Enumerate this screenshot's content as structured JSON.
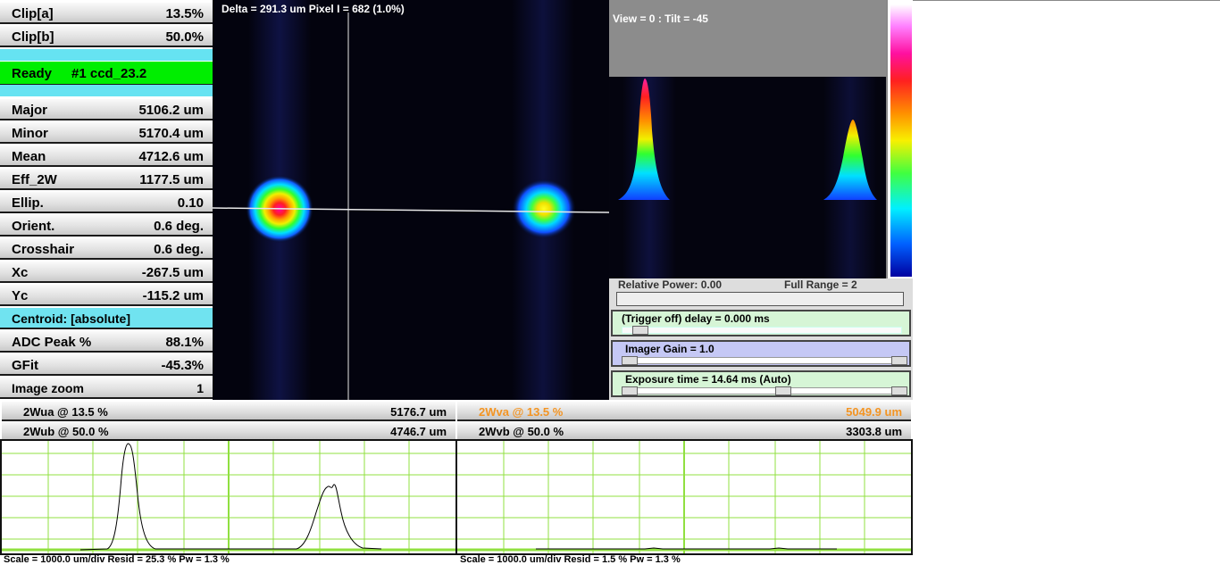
{
  "left_panel": {
    "clip_a": {
      "label": "Clip[a]",
      "value": "13.5%"
    },
    "clip_b": {
      "label": "Clip[b]",
      "value": "50.0%"
    },
    "status": {
      "state": "Ready",
      "camera": "#1 ccd_23.2"
    },
    "measurements": [
      {
        "label": "Major",
        "value": "5106.2 um"
      },
      {
        "label": "Minor",
        "value": "5170.4 um"
      },
      {
        "label": "Mean",
        "value": "4712.6 um"
      },
      {
        "label": "Eff_2W",
        "value": "1177.5 um"
      },
      {
        "label": "Ellip.",
        "value": "0.10"
      },
      {
        "label": "Orient.",
        "value": "0.6 deg."
      },
      {
        "label": "Crosshair",
        "value": "0.6 deg."
      },
      {
        "label": "Xc",
        "value": "-267.5 um"
      },
      {
        "label": "Yc",
        "value": "-115.2 um"
      }
    ],
    "centroid": "Centroid: [absolute]",
    "adc_peak": {
      "label": "ADC Peak %",
      "value": "88.1%"
    },
    "gfit": {
      "label": "GFit",
      "value": "-45.3%"
    },
    "image_zoom": {
      "label": "Image zoom",
      "value": "1"
    }
  },
  "image_view": {
    "header": "Delta = 291.3 um Pixel I = 682 (1.0%)"
  },
  "view3d": {
    "header": "View = 0 : Tilt = -45"
  },
  "controls": {
    "relative_power": "Relative Power: 0.00",
    "full_range": "Full Range = 2",
    "trigger": "(Trigger off) delay = 0.000 ms",
    "imager_gain": "Imager Gain = 1.0",
    "exposure": "Exposure time = 14.64 ms (Auto)"
  },
  "bottom": {
    "wua": {
      "label": "2Wua @ 13.5 %",
      "value": "5176.7 um"
    },
    "wub": {
      "label": "2Wub @ 50.0 %",
      "value": "4746.7 um"
    },
    "wva": {
      "label": "2Wva @ 13.5 %",
      "value": "5049.9 um"
    },
    "wvb": {
      "label": "2Wvb @ 50.0 %",
      "value": "3303.8 um"
    },
    "footer_left": "Scale = 1000.0 um/div        Resid = 25.3 % Pw = 1.3 %",
    "footer_right": "Scale = 1000.0 um/div        Resid = 1.5 % Pw = 1.3 %"
  },
  "colors": {
    "ready": "#00ee00",
    "cyan": "#66e3f2",
    "orange_text": "#f39422",
    "grid": "#90e040"
  }
}
